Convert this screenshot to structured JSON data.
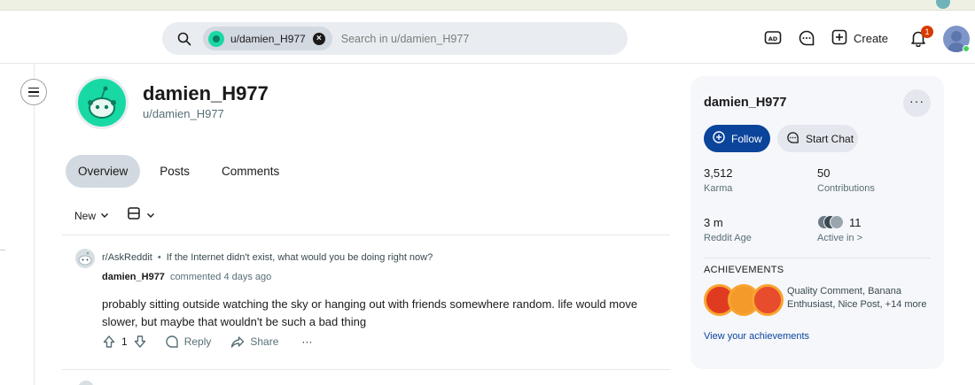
{
  "header": {
    "search_chip_label": "u/damien_H977",
    "search_placeholder": "Search in u/damien_H977",
    "create_label": "Create",
    "notification_count": "1",
    "icons": [
      "search-icon",
      "advertise-icon",
      "chat-icon",
      "create-plus-icon",
      "notification-bell-icon",
      "user-avatar"
    ]
  },
  "profile": {
    "display_name": "damien_H977",
    "handle": "u/damien_H977",
    "avatar_color": "#18d9a3"
  },
  "tabs": [
    "Overview",
    "Posts",
    "Comments"
  ],
  "sort": {
    "label": "New"
  },
  "post": {
    "subreddit": "r/AskReddit",
    "separator": "•",
    "title": "If the Internet didn't exist, what would you be doing right now?",
    "author": "damien_H977",
    "meta": "commented 4 days ago",
    "body": "probably sitting outside watching the sky or hanging out with friends somewhere random. life would move slower, but maybe that wouldn't be such a bad thing",
    "votes": "1",
    "reply_label": "Reply",
    "share_label": "Share",
    "more_label": "···"
  },
  "sidebar": {
    "name": "damien_H977",
    "more_label": "···",
    "follow_label": "Follow",
    "chat_label": "Start Chat",
    "karma_value": "3,512",
    "karma_label": "Karma",
    "contributions_value": "50",
    "contributions_label": "Contributions",
    "age_value": "3 m",
    "age_label": "Reddit Age",
    "active_in_value": "11",
    "active_in_label": "Active in >",
    "achievements_heading": "ACHIEVEMENTS",
    "achievements_text": "Quality Comment, Banana Enthusiast, Nice Post, +14 more",
    "achievements_link": "View your achievements"
  },
  "colors": {
    "follow_button": "#0a449b",
    "notification_badge": "#d93900",
    "accent_green": "#18d9a3"
  }
}
